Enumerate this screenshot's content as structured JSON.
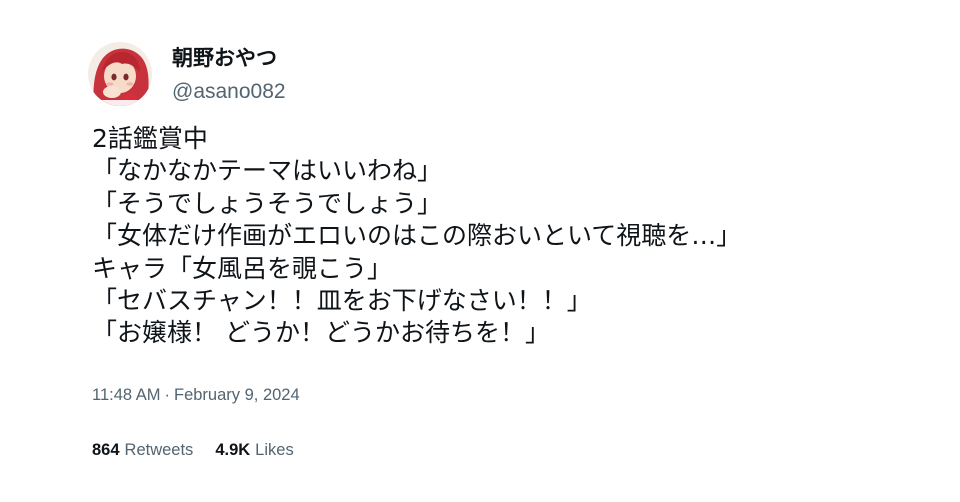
{
  "user": {
    "display_name": "朝野おやつ",
    "handle": "@asano082",
    "avatar_icon": "avatar"
  },
  "tweet": {
    "lines": [
      "2話鑑賞中",
      "「なかなかテーマはいいわね」",
      "「そうでしょうそうでしょう」",
      "「女体だけ作画がエロいのはこの際おいといて視聴を…」",
      "キャラ「女風呂を覗こう」",
      "「セバスチャン！！皿をお下げなさい！！」",
      "「お嬢様！ どうか！どうかお待ちを！」"
    ]
  },
  "timestamp": {
    "time": "11:48 AM",
    "separator": "·",
    "date": "February 9, 2024"
  },
  "stats": {
    "retweets": {
      "count": "864",
      "label": "Retweets"
    },
    "likes": {
      "count": "4.9K",
      "label": "Likes"
    }
  },
  "colors": {
    "background": "#ffffff",
    "text": "#0f1419",
    "secondary": "#536471"
  }
}
